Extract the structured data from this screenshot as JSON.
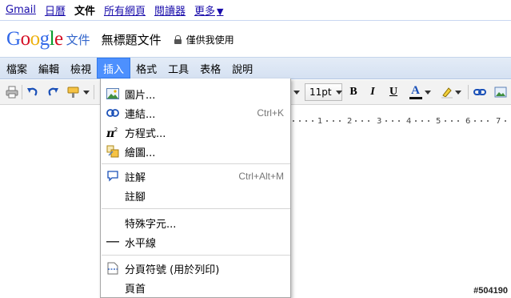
{
  "topnav": {
    "gmail": "Gmail",
    "calendar": "日曆",
    "docs": "文件",
    "all_pages": "所有網頁",
    "reader": "閱讀器",
    "more": "更多",
    "more_caret": "▼"
  },
  "header": {
    "logo": {
      "g1": "G",
      "o1": "o",
      "o2": "o",
      "g2": "g",
      "l": "l",
      "e": "e"
    },
    "product": "文件",
    "doc_title": "無標題文件",
    "privacy": "僅供我使用"
  },
  "menubar": {
    "items": [
      "檔案",
      "編輯",
      "檢視",
      "插入",
      "格式",
      "工具",
      "表格",
      "說明"
    ],
    "active": "插入"
  },
  "toolbar": {
    "font_size": "11pt",
    "bold": "B",
    "italic": "I",
    "underline": "U",
    "text_color": "A",
    "accent": "#1a50b8"
  },
  "ruler": {
    "numbers": [
      "1",
      "2",
      "3",
      "4",
      "5",
      "6",
      "7"
    ]
  },
  "insert_menu": {
    "items": [
      {
        "label": "圖片...",
        "shortcut": "",
        "icon": "image-icon"
      },
      {
        "label": "連結...",
        "shortcut": "Ctrl+K",
        "icon": "link-icon"
      },
      {
        "label": "方程式...",
        "shortcut": "",
        "icon": "equation-icon"
      },
      {
        "label": "繪圖...",
        "shortcut": "",
        "icon": "drawing-icon"
      },
      {
        "label": "註解",
        "shortcut": "Ctrl+Alt+M",
        "icon": "comment-icon"
      },
      {
        "label": "註腳",
        "shortcut": "",
        "icon": ""
      },
      {
        "label": "特殊字元...",
        "shortcut": "",
        "icon": ""
      },
      {
        "label": "水平線",
        "shortcut": "",
        "icon": "horizontal-line-icon"
      },
      {
        "label": "分頁符號 (用於列印)",
        "shortcut": "",
        "icon": "page-break-icon"
      },
      {
        "label": "頁首",
        "shortcut": "",
        "icon": ""
      }
    ]
  },
  "watermark": "#504190"
}
